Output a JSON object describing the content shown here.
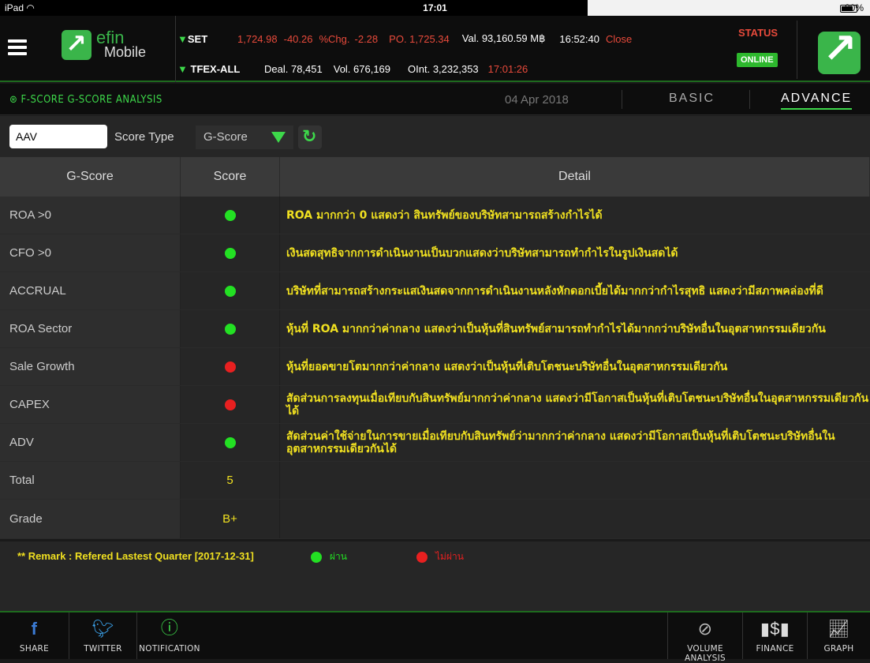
{
  "statusbar": {
    "device": "iPad",
    "time": "17:01",
    "battery": "80%"
  },
  "header": {
    "app_name_top": "efin",
    "app_name_bottom": "Mobile",
    "set": {
      "name": "SET",
      "index": "1,724.98",
      "change": "-40.26",
      "pct_label": "%Chg.",
      "pct": "-2.28",
      "po": "PO. 1,725.34",
      "val": "Val. 93,160.59 M฿",
      "time": "16:52:40",
      "state": "Close"
    },
    "tfex": {
      "name": "TFEX-ALL",
      "deal": "Deal. 78,451",
      "vol": "Vol. 676,169",
      "oint": "OInt. 3,232,353",
      "time": "17:01:26"
    },
    "status_label": "STATUS",
    "status_value": "ONLINE"
  },
  "titlebar": {
    "title": "F-SCORE G-SCORE ANALYSIS",
    "date": "04 Apr 2018",
    "tabs": [
      "BASIC",
      "ADVANCE"
    ],
    "active_tab": "ADVANCE"
  },
  "controls": {
    "symbol": "AAV",
    "score_type_label": "Score Type",
    "score_type_value": "G-Score"
  },
  "table": {
    "headers": [
      "G-Score",
      "Score",
      "Detail"
    ],
    "rows": [
      {
        "name": "ROA >0",
        "score": "green",
        "detail": "ROA มากกว่า 0 แสดงว่า สินทรัพย์ของบริษัทสามารถสร้างกำไรได้"
      },
      {
        "name": "CFO >0",
        "score": "green",
        "detail": "เงินสดสุทธิจากการดำเนินงานเป็นบวกแสดงว่าบริษัทสามารถทำกำไรในรูปเงินสดได้"
      },
      {
        "name": "ACCRUAL",
        "score": "green",
        "detail": "บริษัทที่สามารถสร้างกระแสเงินสดจากการดำเนินงานหลังหักดอกเบี้ยได้มากกว่ากำไรสุทธิ แสดงว่ามีสภาพคล่องที่ดี"
      },
      {
        "name": "ROA Sector",
        "score": "green",
        "detail": "หุ้นที่ ROA มากกว่าค่ากลาง แสดงว่าเป็นหุ้นที่สินทรัพย์สามารถทำกำไรได้มากกว่าบริษัทอื่นในอุตสาหกรรมเดียวกัน"
      },
      {
        "name": "Sale Growth",
        "score": "red",
        "detail": "หุ้นที่ยอดขายโตมากกว่าค่ากลาง แสดงว่าเป็นหุ้นที่เติบโตชนะบริษัทอื่นในอุตสาหกรรมเดียวกัน"
      },
      {
        "name": "CAPEX",
        "score": "red",
        "detail": "สัดส่วนการลงทุนเมื่อเทียบกับสินทรัพย์มากกว่าค่ากลาง แสดงว่ามีโอกาสเป็นหุ้นที่เติบโตชนะบริษัทอื่นในอุตสาหกรรมเดียวกันได้"
      },
      {
        "name": "ADV",
        "score": "green",
        "detail": "สัดส่วนค่าใช้จ่ายในการขายเมื่อเทียบกับสินทรัพย์ว่ามากกว่าค่ากลาง แสดงว่ามีโอกาสเป็นหุ้นที่เติบโตชนะบริษัทอื่นในอุตสาหกรรมเดียวกันได้"
      }
    ],
    "total_label": "Total",
    "total_value": "5",
    "grade_label": "Grade",
    "grade_value": "B+"
  },
  "remark": {
    "text": "** Remark : Refered Lastest Quarter [2017-12-31]",
    "pass": "ผ่าน",
    "fail": "ไม่ผ่าน"
  },
  "bottombar": {
    "items": [
      "SHARE",
      "TWITTER",
      "NOTIFICATION",
      "VOLUME ANALYSIS",
      "FINANCE",
      "GRAPH"
    ]
  },
  "colors": {
    "green": "#23e023",
    "red": "#e82020",
    "accent": "#3dd84a",
    "detail_text": "#f0e020"
  }
}
